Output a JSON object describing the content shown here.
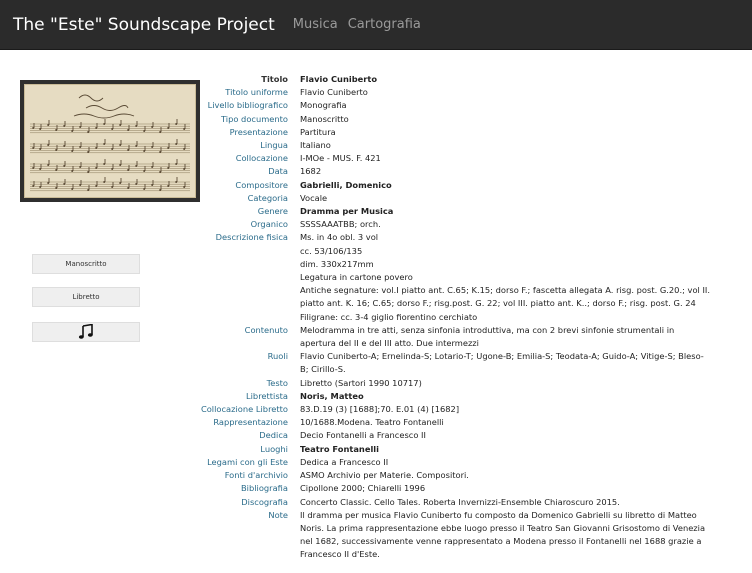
{
  "navbar": {
    "brand": "The \"Este\" Soundscape Project",
    "links": [
      "Musica",
      "Cartografia"
    ]
  },
  "sidebar": {
    "buttons": [
      "Manoscritto",
      "Libretto"
    ],
    "audio_icon": "music-note-icon"
  },
  "colors": {
    "navbar_bg": "#2b2b2b",
    "label": "#2a6b8a",
    "button_bg": "#efefef"
  },
  "record": [
    {
      "label": "Titolo",
      "lines": [
        "Flavio Cuniberto"
      ],
      "bold": true,
      "dark_label": true
    },
    {
      "label": "Titolo uniforme",
      "lines": [
        "Flavio Cuniberto"
      ]
    },
    {
      "label": "Livello bibliografico",
      "lines": [
        "Monografia"
      ]
    },
    {
      "label": "Tipo documento",
      "lines": [
        "Manoscritto"
      ]
    },
    {
      "label": "Presentazione",
      "lines": [
        "Partitura"
      ]
    },
    {
      "label": "Lingua",
      "lines": [
        "Italiano"
      ]
    },
    {
      "label": "Collocazione",
      "lines": [
        "I-MOe - MUS. F. 421"
      ]
    },
    {
      "label": "Data",
      "lines": [
        "1682"
      ]
    },
    {
      "label": "Compositore",
      "lines": [
        "Gabrielli, Domenico"
      ],
      "bold": true
    },
    {
      "label": "Categoria",
      "lines": [
        "Vocale"
      ]
    },
    {
      "label": "Genere",
      "lines": [
        "Dramma per Musica"
      ],
      "bold": true
    },
    {
      "label": "Organico",
      "lines": [
        "SSSSAAATBB; orch."
      ]
    },
    {
      "label": "Descrizione fisica",
      "lines": [
        "Ms. in 4o obl. 3 vol",
        "cc. 53/106/135",
        "dim. 330x217mm",
        "Legatura in cartone povero",
        "Antiche segnature: vol.I piatto ant. C.65; K.15; dorso F.; fascetta allegata A. risg. post. G.20.; vol II.",
        "piatto ant. K. 16; C.65; dorso F.; risg.post. G. 22; vol III. piatto ant. K..; dorso F.; risg. post. G. 24",
        "Filigrane: cc. 3-4 giglio fiorentino cerchiato"
      ]
    },
    {
      "label": "Contenuto",
      "lines": [
        "Melodramma in tre atti, senza sinfonia introduttiva, ma con 2 brevi sinfonie strumentali in",
        "apertura del II e del III atto. Due intermezzi"
      ]
    },
    {
      "label": "Ruoli",
      "lines": [
        "Flavio Cuniberto-A; Ernelinda-S; Lotario-T; Ugone-B; Emilia-S; Teodata-A; Guido-A; Vitige-S; Bleso-",
        "B; Cirillo-S."
      ]
    },
    {
      "label": "Testo",
      "lines": [
        "Libretto (Sartori 1990 10717)"
      ]
    },
    {
      "label": "Librettista",
      "lines": [
        "Noris, Matteo"
      ],
      "bold": true
    },
    {
      "label": "Collocazione Libretto",
      "lines": [
        "83.D.19 (3) [1688];70. E.01 (4) [1682]"
      ]
    },
    {
      "label": "Rappresentazione",
      "lines": [
        "10/1688.Modena. Teatro Fontanelli"
      ]
    },
    {
      "label": "Dedica",
      "lines": [
        "Decio Fontanelli a Francesco II"
      ]
    },
    {
      "label": "Luoghi",
      "lines": [
        "Teatro Fontanelli"
      ],
      "bold": true
    },
    {
      "label": "Legami con gli Este",
      "lines": [
        "Dedica a Francesco II"
      ]
    },
    {
      "label": "Fonti d'archivio",
      "lines": [
        "ASMO Archivio per Materie. Compositori."
      ]
    },
    {
      "label": "Bibliografia",
      "lines": [
        "Cipollone 2000; Chiarelli 1996"
      ]
    },
    {
      "label": "Discografia",
      "lines": [
        "Concerto Classic. Cello Tales. Roberta Invernizzi-Ensemble Chiaroscuro 2015."
      ]
    },
    {
      "label": "Note",
      "lines": [
        "Il dramma per musica Flavio Cuniberto fu composto da Domenico Gabrielli su libretto di Matteo",
        "Noris. La prima rappresentazione ebbe luogo presso il Teatro San Giovanni Grisostomo di Venezia",
        "nel 1682, successivamente venne rappresentato a Modena presso il Fontanelli nel 1688 grazie a",
        "Francesco II d'Este."
      ]
    }
  ]
}
